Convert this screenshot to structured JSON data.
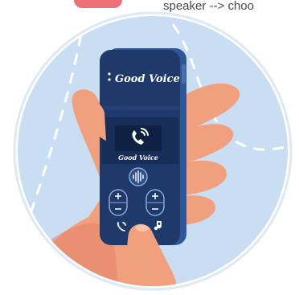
{
  "caption": {
    "text": "speaker --> choo"
  },
  "device": {
    "brand_top": "Good Voice",
    "brand_screen": "Good Voice"
  },
  "colors": {
    "circle_bg": "#c9def2",
    "device_body": "#1e3a6b",
    "device_edge": "#2f5696",
    "skin": "#f1a07e",
    "skin_shadow": "#e27f66",
    "accent_tab": "#ef6f78"
  },
  "icons": [
    "phone-ringing-icon",
    "voice-wave-icon",
    "plus-icon",
    "minus-icon",
    "phone-call-icon",
    "music-note-icon"
  ]
}
